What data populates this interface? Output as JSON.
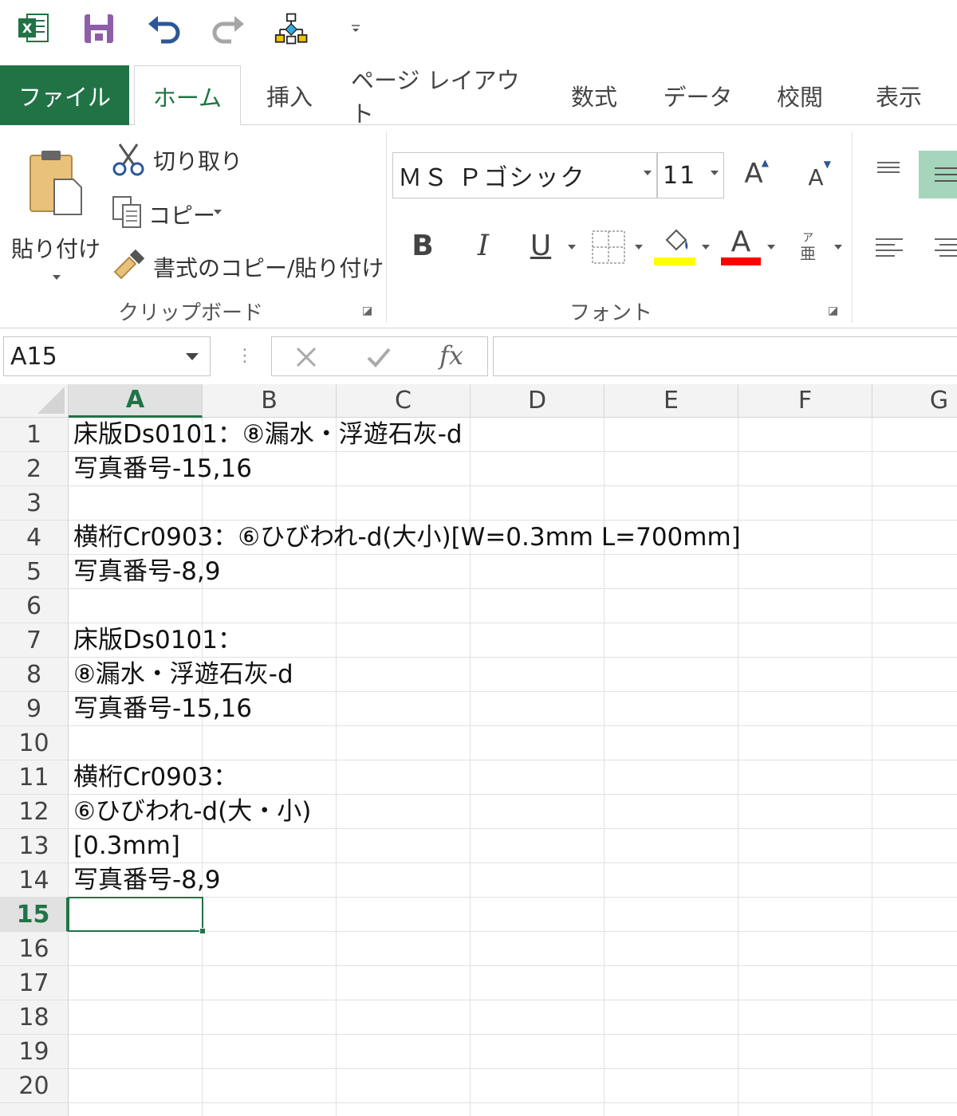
{
  "qat": {
    "icons": [
      "excel-icon",
      "save-icon",
      "undo-icon",
      "redo-icon",
      "diagram-icon",
      "customize-dropdown-icon"
    ]
  },
  "tabs": [
    {
      "label": "ファイル",
      "active": false
    },
    {
      "label": "ホーム",
      "active": true
    },
    {
      "label": "挿入",
      "active": false
    },
    {
      "label": "ページ レイアウト",
      "active": false
    },
    {
      "label": "数式",
      "active": false
    },
    {
      "label": "データ",
      "active": false
    },
    {
      "label": "校閲",
      "active": false
    },
    {
      "label": "表示",
      "active": false
    }
  ],
  "clipboard": {
    "paste_label": "貼り付け",
    "cut_label": "切り取り",
    "copy_label": "コピー",
    "format_painter_label": "書式のコピー/貼り付け",
    "group_label": "クリップボード"
  },
  "font": {
    "font_name": "ＭＳ Ｐゴシック",
    "font_size": "11",
    "bold_label": "B",
    "italic_label": "I",
    "underline_label": "U",
    "grow_label": "A",
    "shrink_label": "A",
    "color_label": "A",
    "group_label": "フォント",
    "highlight_color": "#ffff00",
    "font_color": "#ff0000"
  },
  "formula_bar": {
    "name_box": "A15",
    "fx_label": "fx",
    "formula": ""
  },
  "colors": {
    "accent": "#217346"
  },
  "grid": {
    "columns": [
      "A",
      "B",
      "C",
      "D",
      "E",
      "F",
      "G"
    ],
    "selected_column": "A",
    "rows": [
      "1",
      "2",
      "3",
      "4",
      "5",
      "6",
      "7",
      "8",
      "9",
      "10",
      "11",
      "12",
      "13",
      "14",
      "15",
      "16",
      "17",
      "18",
      "19",
      "20"
    ],
    "selected_row": "15",
    "cells": [
      "床版Ds0101：⑧漏水・浮遊石灰-d",
      "写真番号-15,16",
      "",
      "横桁Cr0903：⑥ひびわれ-d(大小)[W=0.3mm L=700mm]",
      "写真番号-8,9",
      "",
      "床版Ds0101：",
      "⑧漏水・浮遊石灰-d",
      "写真番号-15,16",
      "",
      "横桁Cr0903：",
      "⑥ひびわれ-d(大・小)",
      "[0.3mm]",
      "写真番号-8,9",
      "",
      "",
      "",
      "",
      "",
      ""
    ]
  }
}
